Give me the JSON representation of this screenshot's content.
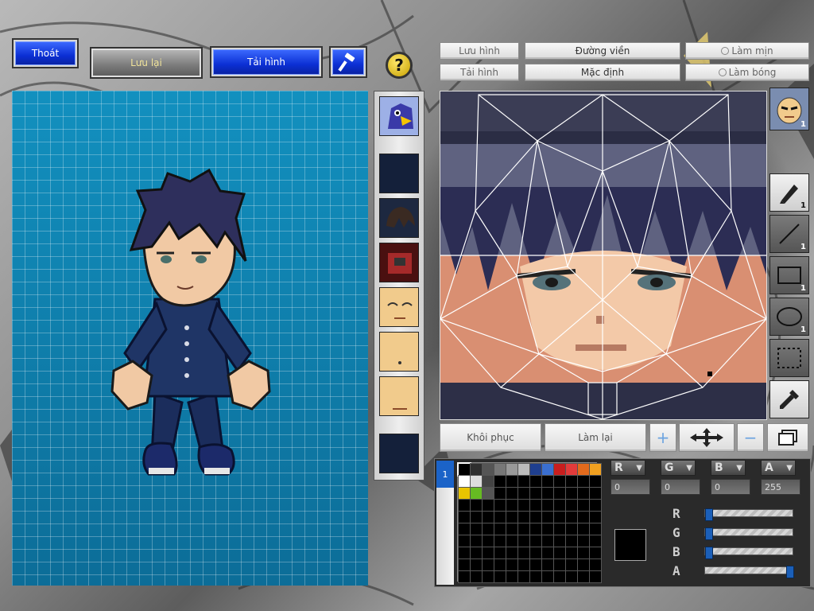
{
  "toolbar": {
    "exit_label": "Thoát",
    "save_label": "Lưu lại",
    "reload_label": "Tải hình",
    "tool_icon": "hammer-icon",
    "help_icon": "question-icon"
  },
  "editor_toolbar": {
    "save_image_label": "Lưu hình",
    "outline_label": "Đường viền",
    "smooth_label": "Làm mịn",
    "load_image_label": "Tải hình",
    "default_label": "Mặc định",
    "shade_label": "Làm bóng"
  },
  "texture_tabs": [
    {
      "icon": "character-face-icon",
      "count": "1"
    }
  ],
  "tools": [
    {
      "icon": "pen-icon",
      "count": "1"
    },
    {
      "icon": "line-icon",
      "count": "1"
    },
    {
      "icon": "rectangle-icon",
      "count": "1"
    },
    {
      "icon": "ellipse-icon",
      "count": "1"
    },
    {
      "icon": "selection-icon",
      "count": ""
    },
    {
      "icon": "eyedropper-icon",
      "count": ""
    }
  ],
  "bottom_bar": {
    "restore_label": "Khôi phục",
    "redo_label": "Làm lại",
    "zoom_icons": [
      "plus-icon",
      "move-arrows-icon",
      "minus-icon",
      "window-icon"
    ]
  },
  "palette": {
    "swatches": [
      "#000000",
      "#2f2f2f",
      "#555555",
      "#777777",
      "#999999",
      "#bbbbbb",
      "#1f3f8f",
      "#3a6fd0",
      "#c81e1e",
      "#e23b3b",
      "#e36a1c",
      "#f0a020",
      "#ffffff",
      "#dddddd",
      "#444444",
      "#000000",
      "#000000",
      "#000000",
      "#000000",
      "#000000",
      "#000000",
      "#000000",
      "#000000",
      "#000000",
      "#e8c400",
      "#66bb22",
      "#555555"
    ],
    "tab_label": "1",
    "selected_color": "#000000"
  },
  "channels": {
    "r": {
      "label": "R",
      "value": "0"
    },
    "g": {
      "label": "G",
      "value": "0"
    },
    "b": {
      "label": "B",
      "value": "0"
    },
    "a": {
      "label": "A",
      "value": "255"
    }
  },
  "sliders": [
    {
      "label": "R",
      "fraction": 0.0
    },
    {
      "label": "G",
      "fraction": 0.0
    },
    {
      "label": "B",
      "fraction": 0.0
    },
    {
      "label": "A",
      "fraction": 1.0
    }
  ]
}
